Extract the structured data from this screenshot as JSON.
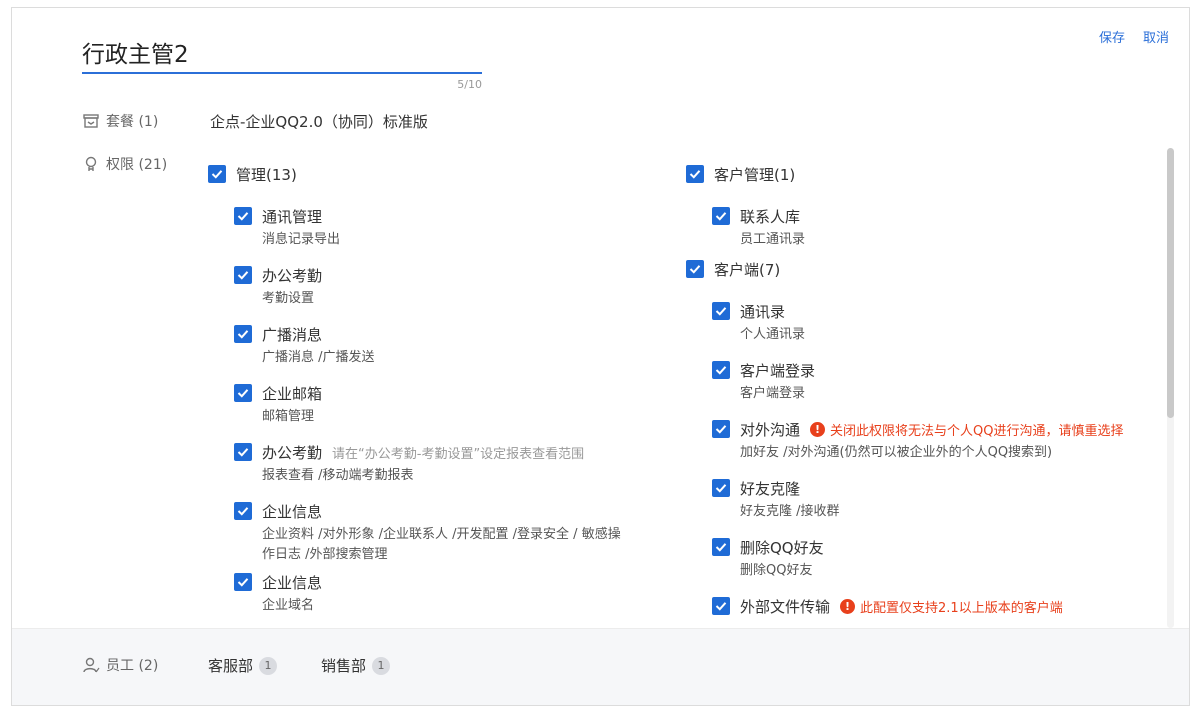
{
  "header": {
    "role_name": "行政主管2",
    "counter": "5/10",
    "save_label": "保存",
    "cancel_label": "取消"
  },
  "package": {
    "label": "套餐 (1)",
    "value": "企点-企业QQ2.0（协同）标准版"
  },
  "permissions": {
    "label": "权限 (21)",
    "left": {
      "group": "管理(13)",
      "items": [
        {
          "name": "通讯管理",
          "desc": "消息记录导出"
        },
        {
          "name": "办公考勤",
          "desc": "考勤设置"
        },
        {
          "name": "广播消息",
          "desc": "广播消息 /广播发送"
        },
        {
          "name": "企业邮箱",
          "desc": "邮箱管理"
        },
        {
          "name": "办公考勤",
          "hint": "请在“办公考勤-考勤设置”设定报表查看范围",
          "desc": "报表查看 /移动端考勤报表"
        },
        {
          "name": "企业信息",
          "desc": "企业资料 /对外形象 /企业联系人 /开发配置 /登录安全 / 敏感操作日志 /外部搜索管理"
        },
        {
          "name": "企业信息",
          "desc": "企业域名"
        }
      ]
    },
    "right": {
      "group1": "客户管理(1)",
      "group1_items": [
        {
          "name": "联系人库",
          "desc": "员工通讯录"
        }
      ],
      "group2": "客户端(7)",
      "group2_items": [
        {
          "name": "通讯录",
          "desc": "个人通讯录"
        },
        {
          "name": "客户端登录",
          "desc": "客户端登录"
        },
        {
          "name": "对外沟通",
          "warning": "关闭此权限将无法与个人QQ进行沟通，请慎重选择",
          "desc": "加好友 /对外沟通(仍然可以被企业外的个人QQ搜索到)"
        },
        {
          "name": "好友克隆",
          "desc": "好友克隆 /接收群"
        },
        {
          "name": "删除QQ好友",
          "desc": "删除QQ好友"
        },
        {
          "name": "外部文件传输",
          "warning": "此配置仅支持2.1以上版本的客户端"
        }
      ]
    }
  },
  "employees": {
    "label": "员工 (2)",
    "departments": [
      {
        "name": "客服部",
        "count": "1"
      },
      {
        "name": "销售部",
        "count": "1"
      }
    ]
  },
  "colors": {
    "accent": "#1f6bd6",
    "link": "#2b6fd8",
    "warning": "#e8401c"
  }
}
